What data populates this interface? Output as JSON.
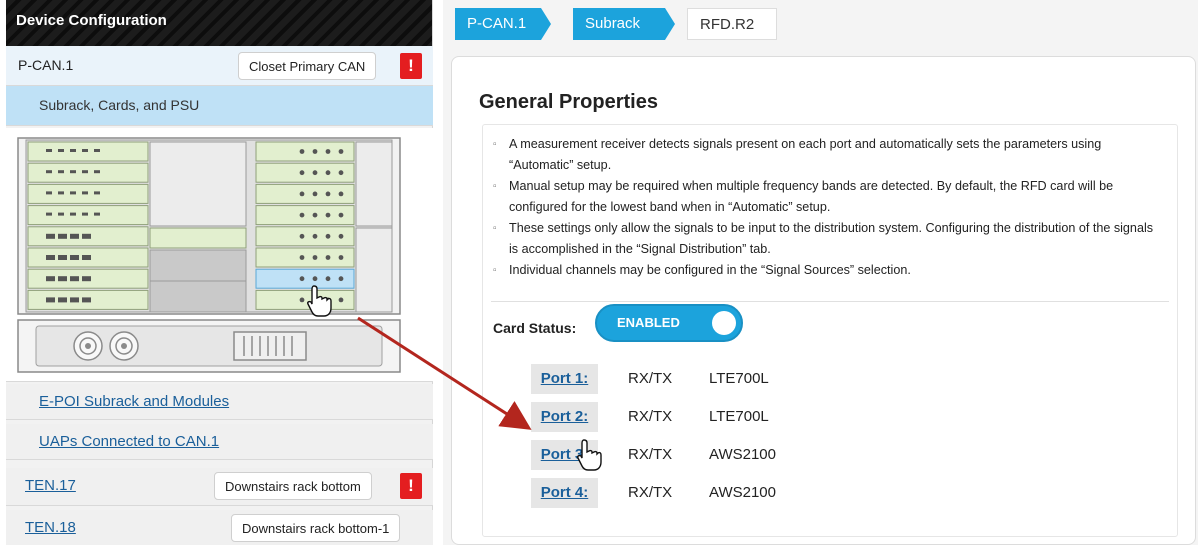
{
  "left": {
    "header": "Device Configuration",
    "pcan": {
      "label": "P-CAN.1",
      "tag": "Closet Primary CAN",
      "alert": "!"
    },
    "subrack_label": "Subrack, Cards, and PSU",
    "links": [
      "E-POI Subrack and Modules",
      "UAPs Connected to CAN.1"
    ],
    "ten_rows": [
      {
        "label": "TEN.17",
        "tag": "Downstairs rack bottom",
        "alert": "!"
      },
      {
        "label": "TEN.18",
        "tag": "Downstairs rack bottom-1"
      }
    ]
  },
  "breadcrumb": [
    "P-CAN.1",
    "Subrack",
    "RFD.R2"
  ],
  "general": {
    "title": "General Properties",
    "bullets": [
      "A measurement receiver detects signals present on each port and automatically sets the parameters using “Automatic” setup.",
      "Manual setup may be required when multiple frequency bands are detected. By default, the RFD card will be configured for the lowest band when in “Automatic” setup.",
      "These settings only allow the signals to be input to the distribution system. Configuring the distribution of the signals is accomplished in the “Signal Distribution” tab.",
      "Individual channels may be configured in the “Signal Sources” selection."
    ],
    "card_status_label": "Card Status:",
    "toggle_label": "ENABLED",
    "ports": [
      {
        "name": "Port 1:",
        "mode": "RX/TX",
        "band": "LTE700L"
      },
      {
        "name": "Port 2:",
        "mode": "RX/TX",
        "band": "LTE700L"
      },
      {
        "name": "Port 3:",
        "mode": "RX/TX",
        "band": "AWS2100"
      },
      {
        "name": "Port 4:",
        "mode": "RX/TX",
        "band": "AWS2100"
      }
    ]
  },
  "colors": {
    "accent": "#1ca3dc",
    "alert": "#e41e20",
    "link": "#1a5f9a",
    "selected_row": "#bfe1f6",
    "card_green": "#e2efcf"
  }
}
